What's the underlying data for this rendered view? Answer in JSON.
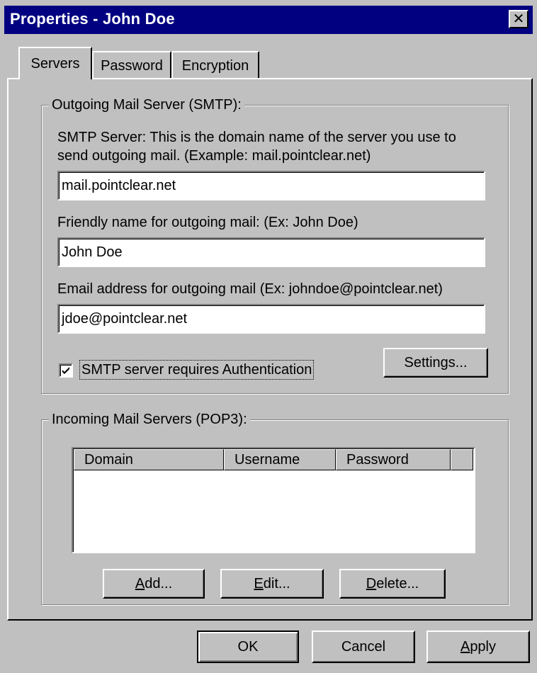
{
  "window": {
    "title": "Properties - John Doe",
    "close_glyph": "✕"
  },
  "tabs": [
    {
      "label": "Servers",
      "active": true
    },
    {
      "label": "Password",
      "active": false
    },
    {
      "label": "Encryption",
      "active": false
    }
  ],
  "smtp_group": {
    "label": "Outgoing Mail Server (SMTP):",
    "server_desc_line1": "SMTP Server:  This is the domain name of the server you use to",
    "server_desc_line2": "send outgoing mail.  (Example: mail.pointclear.net)",
    "server_value": "mail.pointclear.net",
    "friendly_label": "Friendly name for outgoing mail: (Ex: John Doe)",
    "friendly_value": "John Doe",
    "email_label": "Email address for outgoing mail (Ex: johndoe@pointclear.net)",
    "email_value": "jdoe@pointclear.net",
    "auth_label": "SMTP server requires Authentication",
    "auth_checked": true,
    "settings_button": "Settings..."
  },
  "pop3_group": {
    "label": "Incoming Mail Servers (POP3):",
    "columns": [
      "Domain",
      "Username",
      "Password",
      ""
    ],
    "rows": [],
    "add_button": {
      "mnemonic": "A",
      "rest": "dd..."
    },
    "edit_button": {
      "mnemonic": "E",
      "rest": "dit..."
    },
    "delete_button": {
      "mnemonic": "D",
      "rest": "elete..."
    }
  },
  "footer": {
    "ok_button": "OK",
    "cancel_button": "Cancel",
    "apply_button": {
      "mnemonic": "A",
      "rest": "pply"
    }
  },
  "colors": {
    "titlebar": "#000080",
    "face": "#c0c0c0",
    "field": "#ffffff"
  }
}
